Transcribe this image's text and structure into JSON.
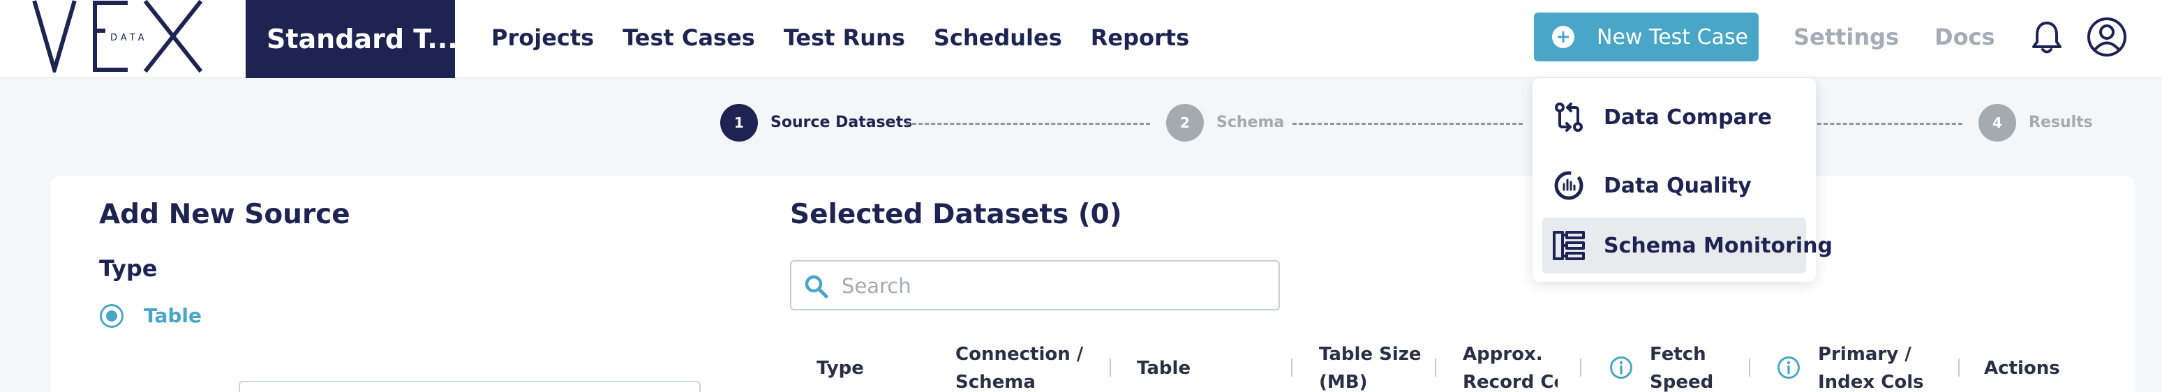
{
  "app": {
    "logo_text": "VEX",
    "logo_sub": "DATA",
    "project_name": "Standard T..."
  },
  "nav": {
    "links": [
      "Projects",
      "Test Cases",
      "Test Runs",
      "Schedules",
      "Reports"
    ],
    "new_button": "New Test Case",
    "settings": "Settings",
    "docs": "Docs"
  },
  "dropdown": {
    "items": [
      {
        "label": "Data Compare",
        "icon": "data-compare-icon"
      },
      {
        "label": "Data Quality",
        "icon": "data-quality-icon"
      },
      {
        "label": "Schema Monitoring",
        "icon": "schema-monitoring-icon"
      }
    ],
    "highlighted_index": 2
  },
  "stepper": {
    "steps": [
      {
        "number": "1",
        "label": "Source Datasets",
        "state": "active"
      },
      {
        "number": "2",
        "label": "Schema",
        "state": "idle"
      },
      {
        "number": "4",
        "label": "Results",
        "state": "idle"
      }
    ]
  },
  "add_source": {
    "title": "Add New Source",
    "type_label": "Type",
    "option": "Table"
  },
  "selected": {
    "title": "Selected Datasets (0)",
    "search_placeholder": "Search",
    "columns": [
      [
        "Type"
      ],
      [
        "Connection /",
        "Schema"
      ],
      [
        "Table"
      ],
      [
        "Table Size",
        "(MB)"
      ],
      [
        "Approx.",
        "Record Cou"
      ],
      [
        "Fetch",
        "Speed"
      ],
      [
        "Primary /",
        "Index Cols"
      ],
      [
        "Actions"
      ]
    ]
  },
  "colors": {
    "primary": "#1d2451",
    "accent": "#4aa6c6",
    "muted": "#a4abb0",
    "background": "#f5f6f7"
  }
}
